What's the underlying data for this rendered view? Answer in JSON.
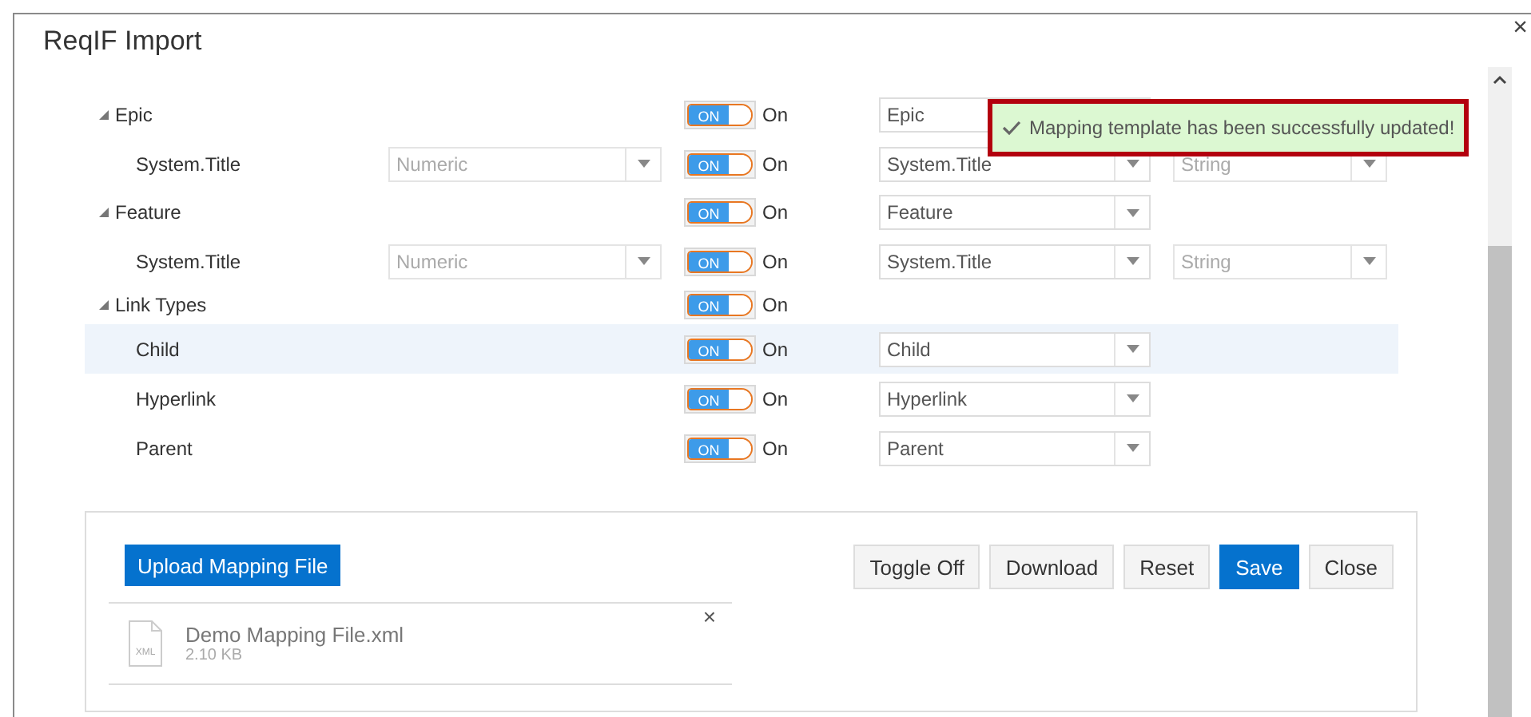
{
  "dialog": {
    "title": "ReqIF Import",
    "close": "×"
  },
  "rows": [
    {
      "name": "Epic",
      "expanded": true,
      "selected": false,
      "toggle": {
        "on": true,
        "badge": "ON",
        "label": "On"
      },
      "target": {
        "value": "Epic",
        "disabled": false
      },
      "children": [
        {
          "name": "System.Title",
          "selected": false,
          "source": {
            "value": "Numeric",
            "disabled": true
          },
          "toggle": {
            "on": true,
            "badge": "ON",
            "label": "On"
          },
          "target": {
            "value": "System.Title",
            "disabled": false
          },
          "data_type": {
            "value": "String",
            "disabled": true
          }
        }
      ]
    },
    {
      "name": "Feature",
      "expanded": true,
      "selected": false,
      "toggle": {
        "on": true,
        "badge": "ON",
        "label": "On"
      },
      "target": {
        "value": "Feature",
        "disabled": false
      },
      "children": [
        {
          "name": "System.Title",
          "selected": false,
          "source": {
            "value": "Numeric",
            "disabled": true
          },
          "toggle": {
            "on": true,
            "badge": "ON",
            "label": "On"
          },
          "target": {
            "value": "System.Title",
            "disabled": false
          },
          "data_type": {
            "value": "String",
            "disabled": true
          }
        }
      ]
    },
    {
      "name": "Link Types",
      "expanded": true,
      "selected": false,
      "toggle": {
        "on": true,
        "badge": "ON",
        "label": "On"
      },
      "children": [
        {
          "name": "Child",
          "selected": true,
          "toggle": {
            "on": true,
            "badge": "ON",
            "label": "On"
          },
          "target": {
            "value": "Child",
            "disabled": false
          }
        },
        {
          "name": "Hyperlink",
          "selected": false,
          "toggle": {
            "on": true,
            "badge": "ON",
            "label": "On"
          },
          "target": {
            "value": "Hyperlink",
            "disabled": false
          }
        },
        {
          "name": "Parent",
          "selected": false,
          "toggle": {
            "on": true,
            "badge": "ON",
            "label": "On"
          },
          "target": {
            "value": "Parent",
            "disabled": false
          }
        }
      ]
    }
  ],
  "toast": {
    "message": "Mapping template has been successfully updated!"
  },
  "upload_button": "Upload Mapping File",
  "file": {
    "type_label": "XML",
    "name": "Demo Mapping File.xml",
    "size": "2.10 KB",
    "remove": "×"
  },
  "buttons": [
    {
      "label": "Toggle Off",
      "kind": "default"
    },
    {
      "label": "Download",
      "kind": "default"
    },
    {
      "label": "Reset",
      "kind": "default"
    },
    {
      "label": "Save",
      "kind": "primary"
    },
    {
      "label": "Close",
      "kind": "default"
    }
  ]
}
